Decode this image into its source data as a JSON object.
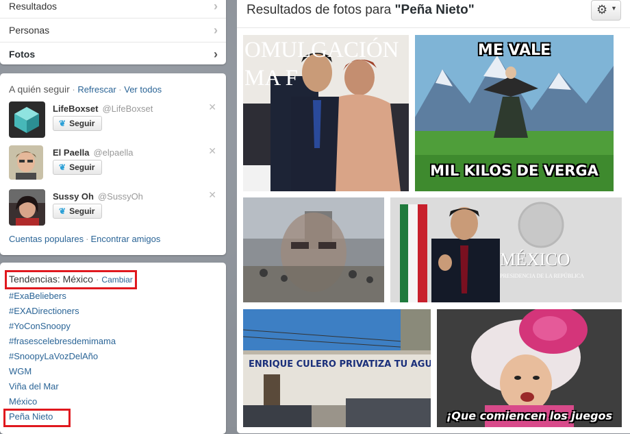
{
  "nav": {
    "items": [
      {
        "label": "Resultados"
      },
      {
        "label": "Personas"
      },
      {
        "label": "Fotos"
      }
    ]
  },
  "who_to_follow": {
    "title": "A quién seguir",
    "refresh": "Refrescar",
    "view_all": "Ver todos",
    "follow_label": "Seguir",
    "users": [
      {
        "name": "LifeBoxset",
        "handle": "@LifeBoxset"
      },
      {
        "name": "El Paella",
        "handle": "@elpaella"
      },
      {
        "name": "Sussy Oh",
        "handle": "@SussyOh"
      }
    ],
    "popular": "Cuentas populares",
    "find_friends": "Encontrar amigos"
  },
  "trends": {
    "title": "Tendencias: México",
    "change": "Cambiar",
    "items": [
      "#ExaBeliebers",
      "#EXADirectioners",
      "#YoConSnoopy",
      "#frasescelebresdemimama",
      "#SnoopyLaVozDelAño",
      "WGM",
      "Viña del Mar",
      "México",
      "Peña Nieto"
    ]
  },
  "main": {
    "title_prefix": "Resultados de fotos para",
    "query": "\"Peña Nieto\""
  },
  "photos": {
    "p1_banner_top": "OMULGACIÓN",
    "p1_banner_mid": "MA F",
    "p2_top": "ME VALE",
    "p2_bottom": "MIL KILOS DE VERGA",
    "p4_seal": "MÉXICO",
    "p4_sub": "PRESIDENCIA DE LA REPÚBLICA",
    "p5_wall": "ENRIQUE CULERO PRIVATIZA TU AGUJERO",
    "p6_caption": "¡Que comiencen los juegos"
  },
  "colors": {
    "highlight": "#e0181e",
    "link": "#2a6496",
    "follow_bird": "#2a9fd6"
  }
}
